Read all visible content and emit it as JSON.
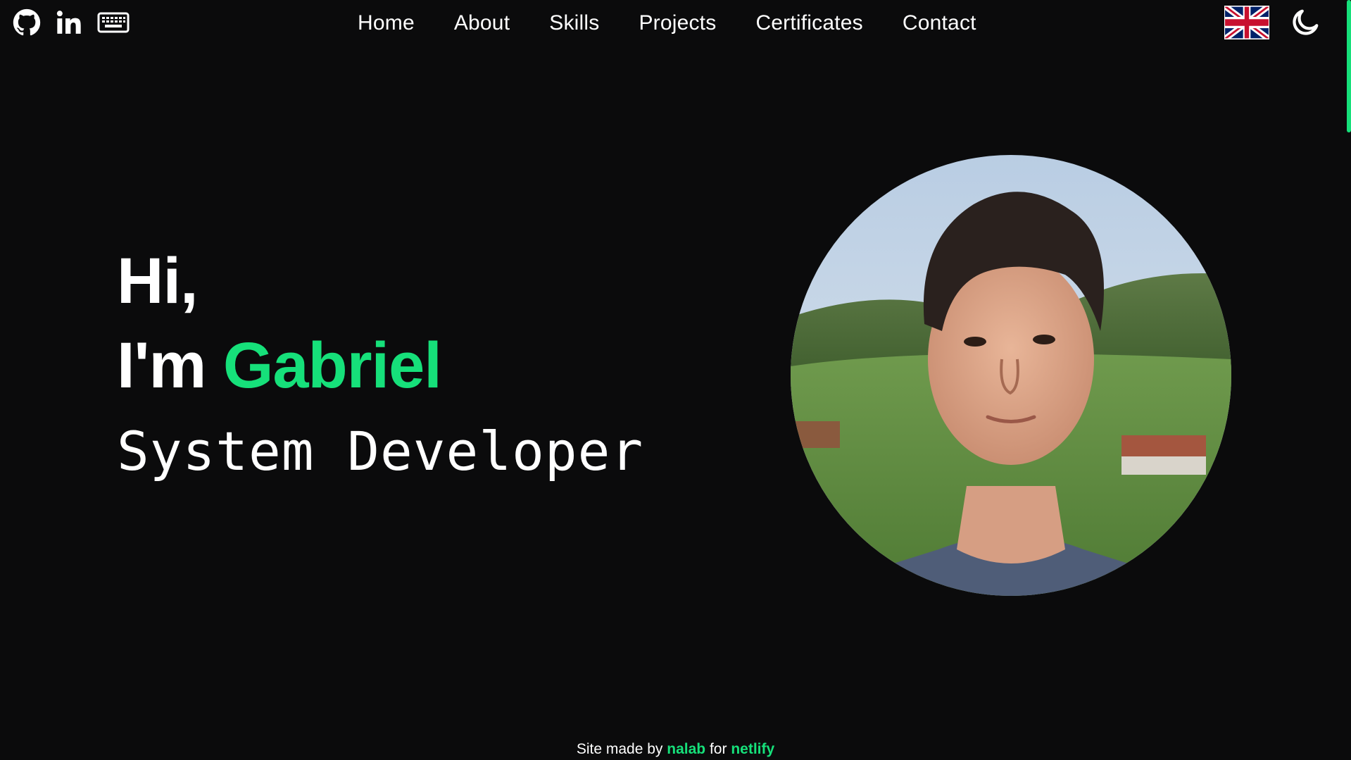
{
  "social": {
    "icons": [
      "github-icon",
      "linkedin-icon",
      "keyboard-icon"
    ]
  },
  "nav": {
    "items": [
      {
        "label": "Home"
      },
      {
        "label": "About"
      },
      {
        "label": "Skills"
      },
      {
        "label": "Projects"
      },
      {
        "label": "Certificates"
      },
      {
        "label": "Contact"
      }
    ]
  },
  "tools": {
    "language_icon": "uk-flag-icon",
    "theme_icon": "moon-icon"
  },
  "hero": {
    "greeting": "Hi,",
    "intro": "I'm",
    "name": "Gabriel",
    "role": "System Developer"
  },
  "footer": {
    "prefix": "Site made by",
    "author": "nalab",
    "middle": "for",
    "host": "netlify"
  },
  "colors": {
    "background": "#0b0b0c",
    "accent": "#16e07a",
    "text": "#ffffff"
  }
}
